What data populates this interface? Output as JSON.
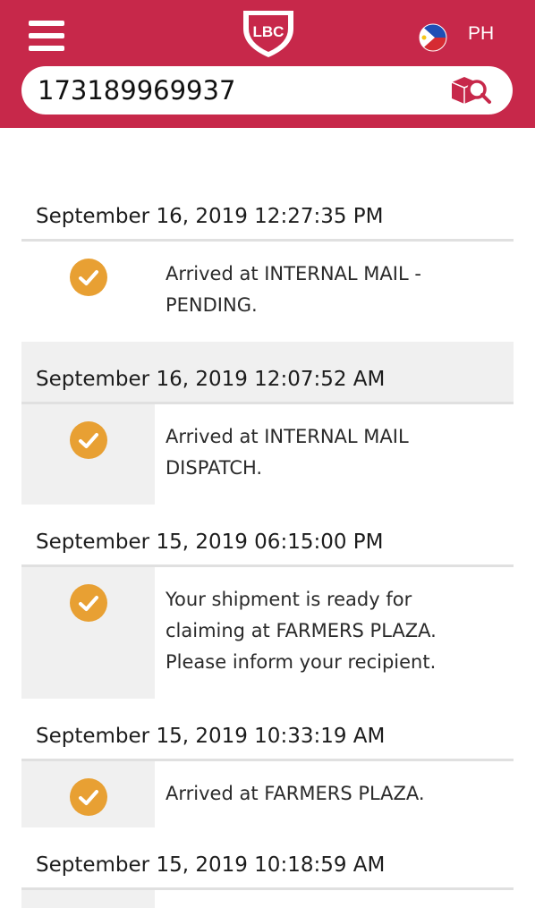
{
  "header": {
    "logo_text": "LBC",
    "country_code": "PH"
  },
  "search": {
    "tracking_number": "173189969937"
  },
  "icons": {
    "menu": "hamburger-menu-icon",
    "flag": "philippines-flag-icon",
    "search": "package-search-icon",
    "status": "checkmark-circle-icon"
  },
  "colors": {
    "brand": "#c7284a",
    "check": "#e8a033",
    "band": "#f0f0f0"
  },
  "timeline": [
    {
      "date": "September 16, 2019 12:27:35 PM",
      "message": [
        "Arrived at INTERNAL MAIL -",
        "PENDING."
      ]
    },
    {
      "date": "September 16, 2019 12:07:52 AM",
      "message": [
        "Arrived at INTERNAL MAIL",
        "DISPATCH."
      ]
    },
    {
      "date": "September 15, 2019 06:15:00 PM",
      "message": [
        "Your shipment is ready for",
        "claiming at FARMERS PLAZA.",
        "Please inform your recipient."
      ]
    },
    {
      "date": "September 15, 2019 10:33:19 AM",
      "message": [
        "Arrived at FARMERS PLAZA."
      ]
    },
    {
      "date": "September 15, 2019 10:18:59 AM",
      "message": []
    }
  ]
}
